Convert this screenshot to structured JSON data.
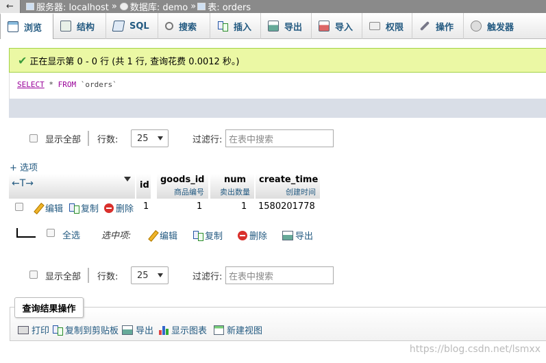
{
  "breadcrumb": {
    "back": "←",
    "server_label": "服务器: localhost",
    "db_label": "数据库: demo",
    "table_label": "表: orders",
    "sep": "»"
  },
  "tabs": [
    {
      "label": "浏览",
      "icon": "browse-icon"
    },
    {
      "label": "结构",
      "icon": "structure-icon"
    },
    {
      "label": "SQL",
      "icon": "sql-icon"
    },
    {
      "label": "搜索",
      "icon": "search-icon"
    },
    {
      "label": "插入",
      "icon": "insert-icon"
    },
    {
      "label": "导出",
      "icon": "export-icon"
    },
    {
      "label": "导入",
      "icon": "import-icon"
    },
    {
      "label": "权限",
      "icon": "privileges-icon"
    },
    {
      "label": "操作",
      "icon": "wrench-icon"
    },
    {
      "label": "触发器",
      "icon": "triggers-icon"
    }
  ],
  "message": "正在显示第 0 - 0 行 (共 1 行, 查询花费 0.0012 秒。)",
  "sql": {
    "keyword1": "SELECT",
    "rest1": " * ",
    "keyword2": "FROM",
    "rest2": " `orders`"
  },
  "nav": {
    "show_all": "显示全部",
    "rows_label": "行数:",
    "rows_value": "25",
    "filter_label": "过滤行:",
    "filter_placeholder": "在表中搜索"
  },
  "options_link": "+ 选项",
  "table": {
    "arrows": "←T→",
    "columns": [
      {
        "name": "id",
        "comment": ""
      },
      {
        "name": "goods_id",
        "comment": "商品编号"
      },
      {
        "name": "num",
        "comment": "卖出数量"
      },
      {
        "name": "create_time",
        "comment": "创建时间"
      }
    ],
    "row_actions": {
      "edit": "编辑",
      "copy": "复制",
      "delete": "删除"
    },
    "rows": [
      {
        "id": "1",
        "goods_id": "1",
        "num": "1",
        "create_time": "1580201778"
      }
    ]
  },
  "bulk": {
    "select_all": "全选",
    "with_selected": "选中项:",
    "edit": "编辑",
    "copy": "复制",
    "delete": "删除",
    "export": "导出"
  },
  "ops": {
    "title": "查询结果操作",
    "print": "打印",
    "copy_clipboard": "复制到剪贴板",
    "export": "导出",
    "chart": "显示图表",
    "new_view": "新建视图"
  },
  "watermark": "https://blog.csdn.net/lsmxx"
}
